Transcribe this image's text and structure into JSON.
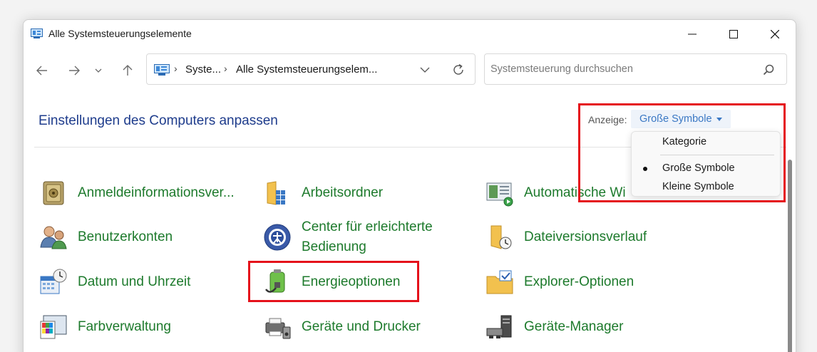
{
  "window": {
    "title": "Alle Systemsteuerungselemente"
  },
  "address": {
    "crumbs": [
      "Syste...",
      "Alle Systemsteuerungselem..."
    ]
  },
  "search": {
    "placeholder": "Systemsteuerung durchsuchen"
  },
  "header": {
    "title": "Einstellungen des Computers anpassen",
    "view_label": "Anzeige:",
    "view_value": "Große Symbole"
  },
  "view_menu": {
    "items": [
      {
        "label": "Kategorie",
        "selected": false
      },
      {
        "label": "Große Symbole",
        "selected": true
      },
      {
        "label": "Kleine Symbole",
        "selected": false
      }
    ]
  },
  "items": [
    {
      "label": "Anmeldeinformationsver...",
      "icon": "credential-vault-icon"
    },
    {
      "label": "Arbeitsordner",
      "icon": "work-folders-icon"
    },
    {
      "label": "Automatische Wi",
      "icon": "autoplay-icon"
    },
    {
      "label": "Benutzerkonten",
      "icon": "user-accounts-icon"
    },
    {
      "label": "Center für erleichterte Bedienung",
      "icon": "ease-of-access-icon"
    },
    {
      "label": "Dateiversionsverlauf",
      "icon": "file-history-icon"
    },
    {
      "label": "Datum und Uhrzeit",
      "icon": "date-time-icon"
    },
    {
      "label": "Energieoptionen",
      "icon": "power-options-icon"
    },
    {
      "label": "Explorer-Optionen",
      "icon": "explorer-options-icon"
    },
    {
      "label": "Farbverwaltung",
      "icon": "color-management-icon"
    },
    {
      "label": "Geräte und Drucker",
      "icon": "devices-printers-icon"
    },
    {
      "label": "Geräte-Manager",
      "icon": "device-manager-icon"
    }
  ],
  "colors": {
    "item_link": "#1d7a2c",
    "title": "#1e3c8c",
    "highlight": "#e5121b",
    "view_link": "#3a78c4"
  }
}
